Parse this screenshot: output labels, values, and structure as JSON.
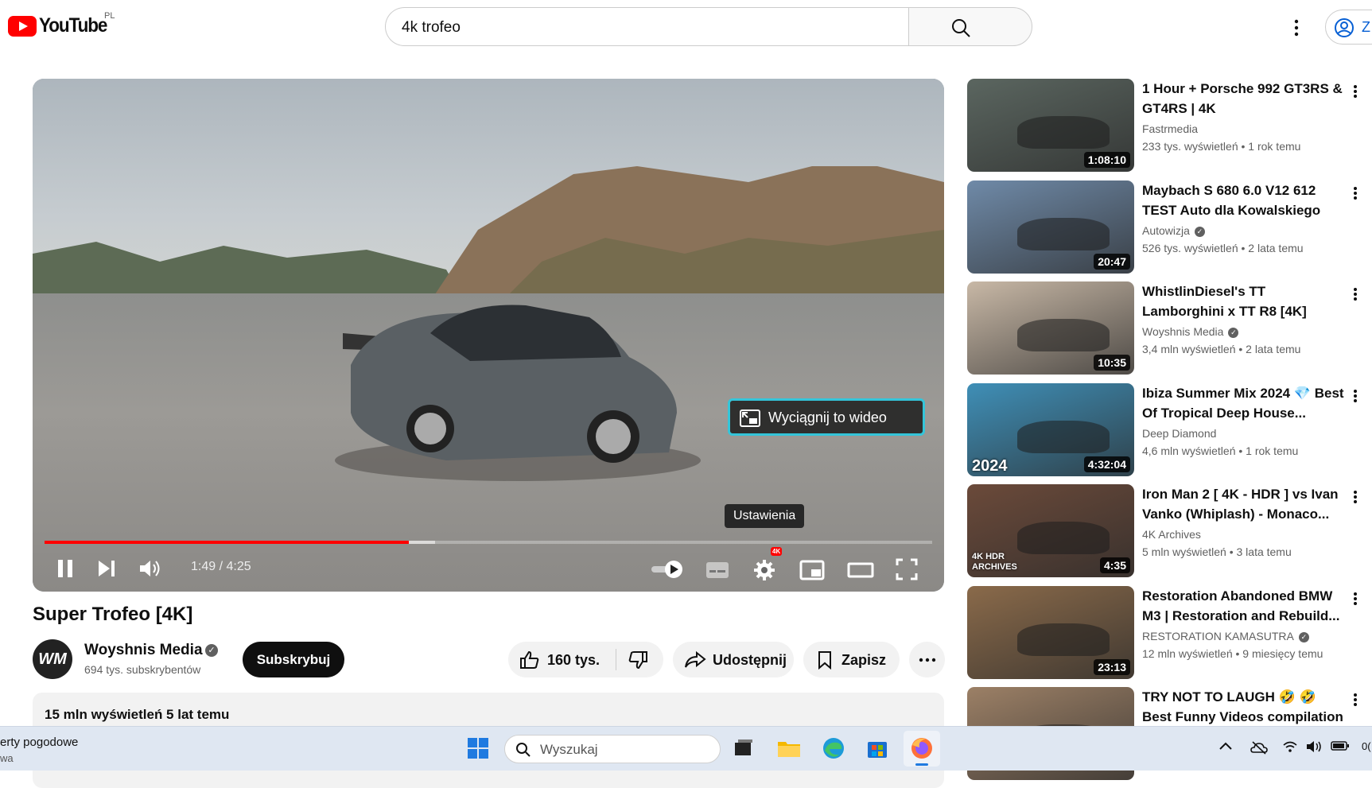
{
  "header": {
    "logo_text": "YouTube",
    "region": "PL",
    "search_value": "4k trofeo",
    "signin_label": "Z"
  },
  "player": {
    "pip_label": "Wyciągnij to wideo",
    "tooltip": "Ustawienia",
    "time": "1:49 / 4:25",
    "progress_fraction": 0.41,
    "buffer_fraction": 0.44,
    "quality_badge": "4K"
  },
  "video": {
    "title": "Super Trofeo [4K]",
    "channel": "Woyshnis Media",
    "channel_avatar": "WM",
    "subscribers": "694 tys. subskrybentów",
    "subscribe_label": "Subskrybuj",
    "likes": "160 tys.",
    "share_label": "Udostępnij",
    "save_label": "Zapisz",
    "views_date": "15 mln wyświetleń  5 lat temu"
  },
  "recommendations": [
    {
      "title": "1 Hour + Porsche 992 GT3RS & GT4RS | 4K",
      "channel": "Fastrmedia",
      "verified": false,
      "meta": "233 tys. wyświetleń  • 1 rok temu",
      "duration": "1:08:10",
      "bg": "#5b6660"
    },
    {
      "title": "Maybach S 680 6.0 V12 612 TEST Auto dla Kowalskiego za...",
      "channel": "Autowizja",
      "verified": true,
      "meta": "526 tys. wyświetleń  • 2 lata temu",
      "duration": "20:47",
      "bg": "#6f8aa8"
    },
    {
      "title": "WhistlinDiesel's TT Lamborghini x TT R8 [4K]",
      "channel": "Woyshnis Media",
      "verified": true,
      "meta": "3,4 mln wyświetleń  • 2 lata temu",
      "duration": "10:35",
      "bg": "#c8b8a6"
    },
    {
      "title": "Ibiza Summer Mix 2024 💎 Best Of Tropical Deep House...",
      "channel": "Deep Diamond",
      "verified": false,
      "meta": "4,6 mln wyświetleń  • 1 rok temu",
      "duration": "4:32:04",
      "bg": "#3f8fb7",
      "overlay": "2024"
    },
    {
      "title": "Iron Man 2 [ 4K - HDR ] vs Ivan Vanko (Whiplash) - Monaco...",
      "channel": "4K Archives",
      "verified": false,
      "meta": "5 mln wyświetleń  • 3 lata temu",
      "duration": "4:35",
      "bg": "#6b4a3a",
      "overlay": "4K HDR ARCHIVES"
    },
    {
      "title": "Restoration Abandoned BMW M3 | Restoration and Rebuild...",
      "channel": "RESTORATION KAMASUTRA",
      "verified": true,
      "meta": "12 mln wyświetleń  • 9 miesięcy temu",
      "duration": "23:13",
      "bg": "#8a6a4a"
    },
    {
      "title": "TRY NOT TO LAUGH 🤣 🤣 Best Funny Videos compilation - Fa...",
      "channel": "",
      "verified": false,
      "meta": "",
      "duration": "",
      "bg": "#9c8066"
    }
  ],
  "taskbar": {
    "weather_line1": "erty pogodowe",
    "weather_line2": "wa",
    "search_placeholder": "Wyszukaj",
    "clock": "0("
  },
  "colors": {
    "accent_red": "#ff0000",
    "link_blue": "#065fd4",
    "pip_border": "#34c5d9"
  }
}
